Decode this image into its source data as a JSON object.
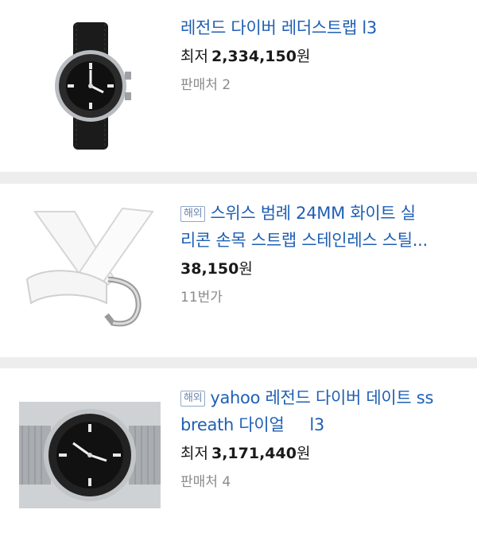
{
  "products": [
    {
      "title": "레전드 다이버 레더스트랩 l3",
      "badge": "",
      "price_prefix": "최저",
      "price": "2,334,150",
      "price_unit": "원",
      "seller": "판매처 2"
    },
    {
      "title_line1": "스위스 범례 24MM 화이트 실",
      "title_line2": "리콘 손목 스트랩 스테인레스 스틸...",
      "badge": "해외",
      "price": "38,150",
      "price_unit": "원",
      "seller": "11번가"
    },
    {
      "title_line1": "yahoo 레전드 다이버 데이트 ss",
      "title_line2": "breath 다이얼     l3",
      "badge": "해외",
      "price_prefix": "최저",
      "price": "3,171,440",
      "price_unit": "원",
      "seller": "판매처 4"
    }
  ]
}
